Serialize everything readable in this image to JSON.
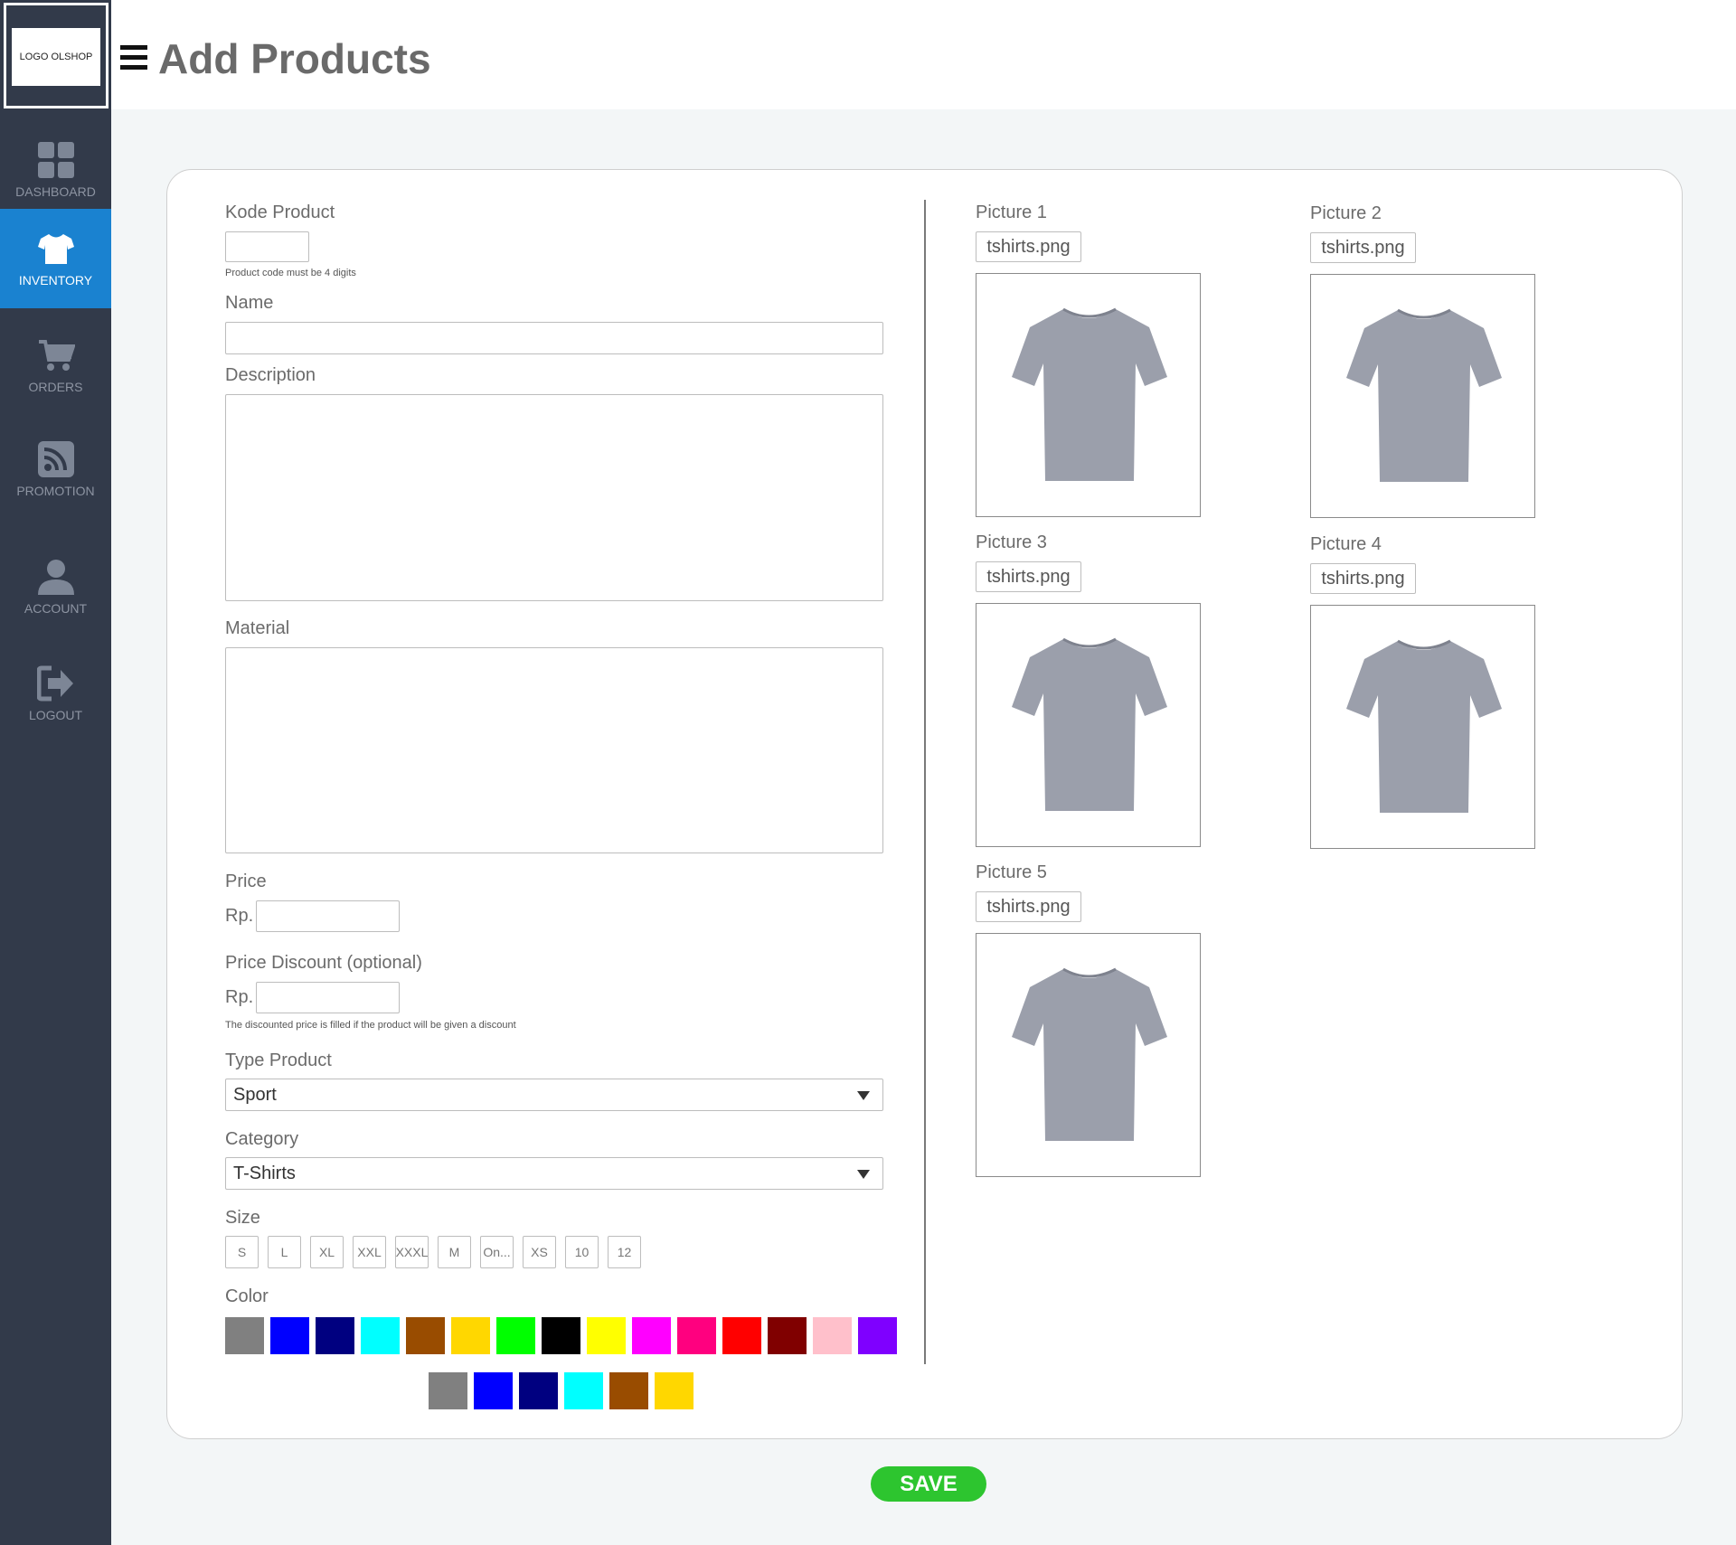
{
  "sidebar": {
    "logo_text": "LOGO OLSHOP",
    "items": [
      {
        "label": "DASHBOARD",
        "icon": "dashboard-icon"
      },
      {
        "label": "INVENTORY",
        "icon": "tshirt-icon",
        "active": true
      },
      {
        "label": "ORDERS",
        "icon": "cart-icon"
      },
      {
        "label": "PROMOTION",
        "icon": "rss-icon"
      },
      {
        "label": "ACCOUNT",
        "icon": "user-icon"
      },
      {
        "label": "LOGOUT",
        "icon": "logout-icon"
      }
    ]
  },
  "header": {
    "menu_icon": "hamburger-icon",
    "title": "Add Products"
  },
  "form": {
    "kode_label": "Kode Product",
    "kode_value": "",
    "kode_hint": "Product code must be 4 digits",
    "name_label": "Name",
    "name_value": "",
    "description_label": "Description",
    "description_value": "",
    "material_label": "Material",
    "material_value": "",
    "price_label": "Price",
    "price_prefix": "Rp.",
    "price_value": "",
    "discount_label": "Price Discount (optional)",
    "discount_prefix": "Rp.",
    "discount_value": "",
    "discount_hint": "The discounted price is filled if the product will be given a discount",
    "type_label": "Type Product",
    "type_value": "Sport",
    "category_label": "Category",
    "category_value": "T-Shirts",
    "size_label": "Size",
    "sizes": [
      "S",
      "L",
      "XL",
      "XXL",
      "XXXL",
      "M",
      "On...",
      "XS",
      "10",
      "12"
    ],
    "color_label": "Color",
    "colors_row1": [
      "#808080",
      "#0000ff",
      "#000080",
      "#00ffff",
      "#994c00",
      "#ffd700",
      "#00ff00",
      "#000000",
      "#ffff00",
      "#ff00ff",
      "#ff007f",
      "#ff0000",
      "#800000",
      "#ffc0cb",
      "#7f00ff"
    ],
    "colors_row2": [
      "#808080",
      "#0000ff",
      "#000080",
      "#00ffff",
      "#994c00",
      "#ffd700"
    ]
  },
  "pictures": [
    {
      "label": "Picture 1",
      "file": "tshirts.png"
    },
    {
      "label": "Picture 2",
      "file": "tshirts.png"
    },
    {
      "label": "Picture 3",
      "file": "tshirts.png"
    },
    {
      "label": "Picture 4",
      "file": "tshirts.png"
    },
    {
      "label": "Picture 5",
      "file": "tshirts.png"
    }
  ],
  "actions": {
    "save_label": "SAVE",
    "save_color": "#2dc52f"
  }
}
